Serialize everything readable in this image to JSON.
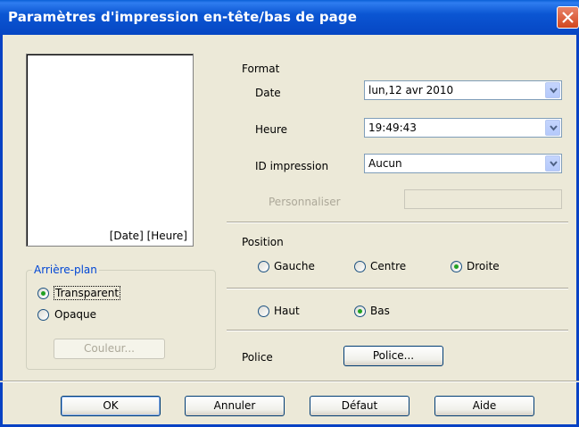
{
  "window": {
    "title": "Paramètres d'impression en-tête/bas de page"
  },
  "preview": {
    "text": "[Date] [Heure]"
  },
  "background": {
    "legend": "Arrière-plan",
    "options": [
      {
        "label": "Transparent",
        "selected": true
      },
      {
        "label": "Opaque",
        "selected": false
      }
    ],
    "color_button": "Couleur..."
  },
  "format": {
    "heading": "Format",
    "date": {
      "label": "Date",
      "value": "lun,12 avr 2010"
    },
    "time": {
      "label": "Heure",
      "value": "19:49:43"
    },
    "print_id": {
      "label": "ID impression",
      "value": "Aucun"
    },
    "customize": {
      "label": "Personnaliser",
      "value": ""
    }
  },
  "position": {
    "heading": "Position",
    "horizontal": [
      {
        "label": "Gauche",
        "selected": false
      },
      {
        "label": "Centre",
        "selected": false
      },
      {
        "label": "Droite",
        "selected": true
      }
    ],
    "vertical": [
      {
        "label": "Haut",
        "selected": false
      },
      {
        "label": "Bas",
        "selected": true
      }
    ]
  },
  "font": {
    "label": "Police",
    "button": "Police..."
  },
  "buttons": {
    "ok": "OK",
    "cancel": "Annuler",
    "default": "Défaut",
    "help": "Aide"
  },
  "colors": {
    "title_bar": "#0a56d3",
    "dialog_bg": "#ece9d8",
    "group_legend": "#0046d5",
    "radio_dot": "#21a121",
    "close_button": "#d2461e"
  }
}
